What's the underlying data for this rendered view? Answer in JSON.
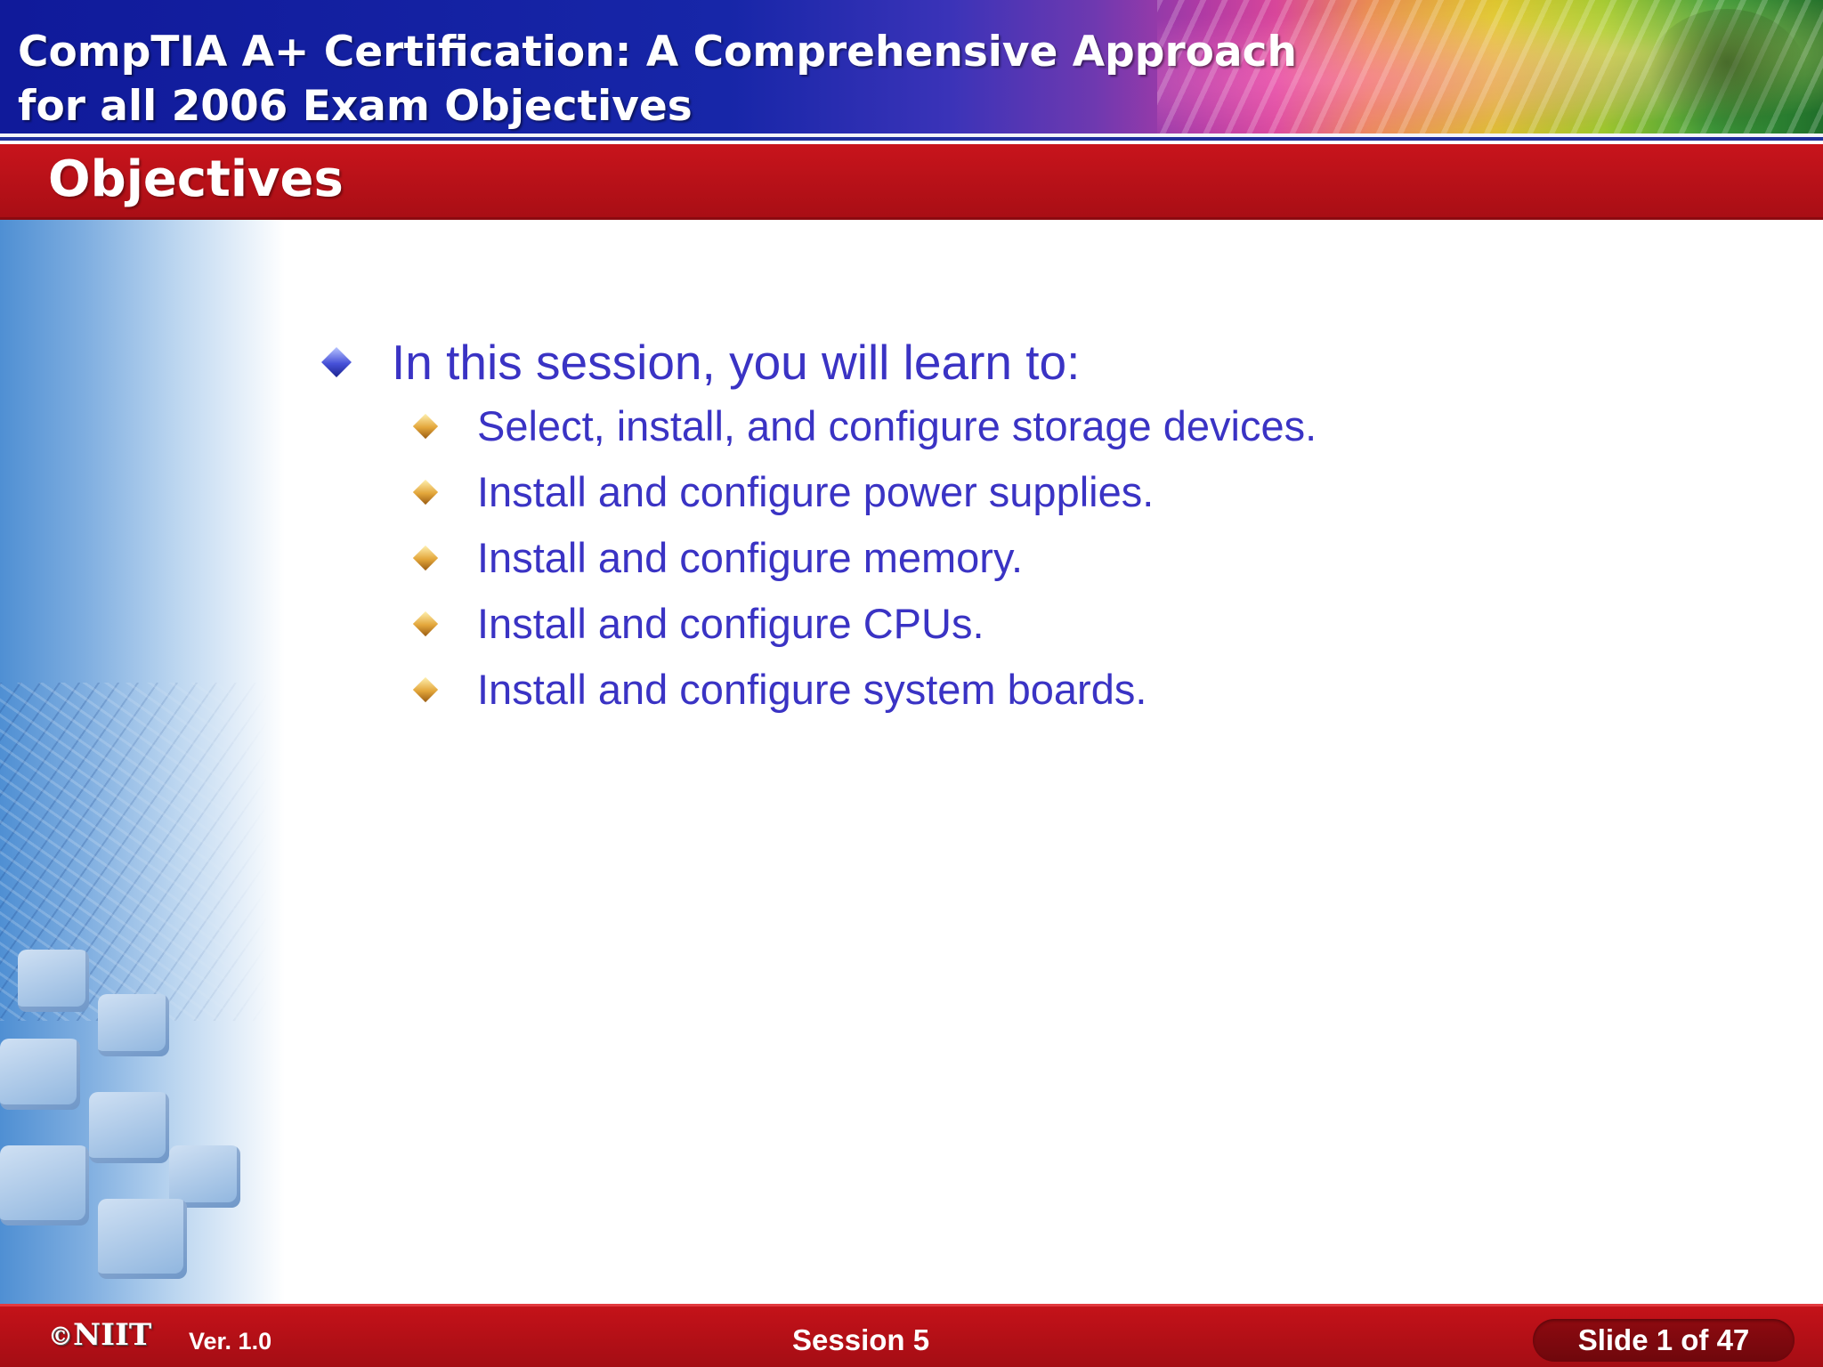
{
  "header": {
    "course_title_line1": "CompTIA A+ Certification: A Comprehensive Approach",
    "course_title_line2": "for all 2006 Exam Objectives"
  },
  "section": {
    "title": "Objectives"
  },
  "content": {
    "main_bullet": "In this session, you will learn to:",
    "sub_bullets": [
      "Select, install, and configure storage devices.",
      "Install and configure power supplies.",
      "Install and configure memory.",
      "Install and configure CPUs.",
      "Install and configure system boards."
    ]
  },
  "footer": {
    "logo_symbol": "©",
    "logo_text": "NIIT",
    "version": "Ver.  1.0",
    "session": "Session 5",
    "slide_number": "Slide 1 of 47"
  },
  "colors": {
    "header_blue": "#1726a8",
    "bar_red": "#b3101a",
    "text_blue": "#3a33c4",
    "bullet_blue": "#4650d8",
    "bullet_gold": "#e3a63a"
  },
  "icons": {
    "main_bullet": "diamond-bullet-icon",
    "sub_bullet": "gold-diamond-bullet-icon"
  }
}
